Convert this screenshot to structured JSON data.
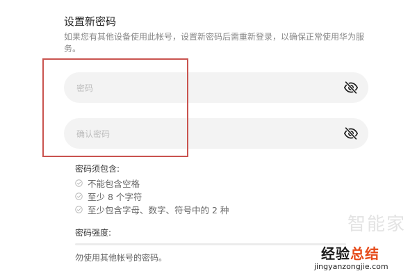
{
  "form": {
    "title": "设置新密码",
    "description": "如果您有其他设备使用此帐号，设置新密码后需重新登录，以确保正常使用华为服务。",
    "password": {
      "value": "",
      "placeholder": "密码"
    },
    "confirm_password": {
      "value": "",
      "placeholder": "确认密码"
    },
    "icons": {
      "toggle_visibility": "eye-slash-icon",
      "rule_status": "check-circle-icon"
    },
    "requirements": {
      "title": "密码须包含:",
      "rules": [
        {
          "label": "不能包含空格"
        },
        {
          "label": "至少 8 个字符"
        },
        {
          "label": "至少包含字母、数字、符号中的 2 种"
        }
      ]
    },
    "strength": {
      "label": "密码强度:",
      "level": 0
    },
    "tip": "勿使用其他帐号的密码。"
  },
  "watermark": {
    "faint_text": "智能家",
    "main_text_prefix": "经验",
    "main_text_accent": "总结",
    "url": "jingyanzongjie.com"
  },
  "colors": {
    "field_bg": "#f3f3f3",
    "highlight_border": "#c9534f",
    "watermark_accent": "#e64a19"
  }
}
